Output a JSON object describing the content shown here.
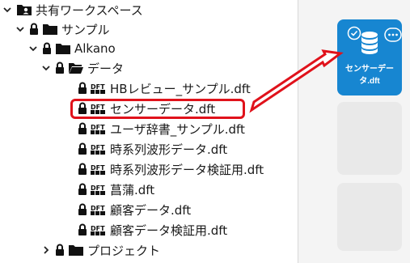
{
  "tree": {
    "items": [
      {
        "label": "共有ワークスペース",
        "kind": "root"
      },
      {
        "label": "サンプル",
        "kind": "folder"
      },
      {
        "label": "Alkano",
        "kind": "folder"
      },
      {
        "label": "データ",
        "kind": "folder"
      },
      {
        "label": "HBレビュー_サンプル.dft",
        "kind": "file"
      },
      {
        "label": "センサーデータ.dft",
        "kind": "file",
        "highlighted": true
      },
      {
        "label": "ユーザ辞書_サンプル.dft",
        "kind": "file"
      },
      {
        "label": "時系列波形データ.dft",
        "kind": "file"
      },
      {
        "label": "時系列波形データ検証用.dft",
        "kind": "file"
      },
      {
        "label": "菖蒲.dft",
        "kind": "file"
      },
      {
        "label": "顧客データ.dft",
        "kind": "file"
      },
      {
        "label": "顧客データ検証用.dft",
        "kind": "file"
      },
      {
        "label": "プロジェクト",
        "kind": "folder"
      }
    ],
    "file_badge": "DFT"
  },
  "panel": {
    "card_title": "センサーデータ.dft"
  },
  "colors": {
    "accent": "#1786d1",
    "highlight": "#e0121b",
    "icon": "#111111"
  }
}
